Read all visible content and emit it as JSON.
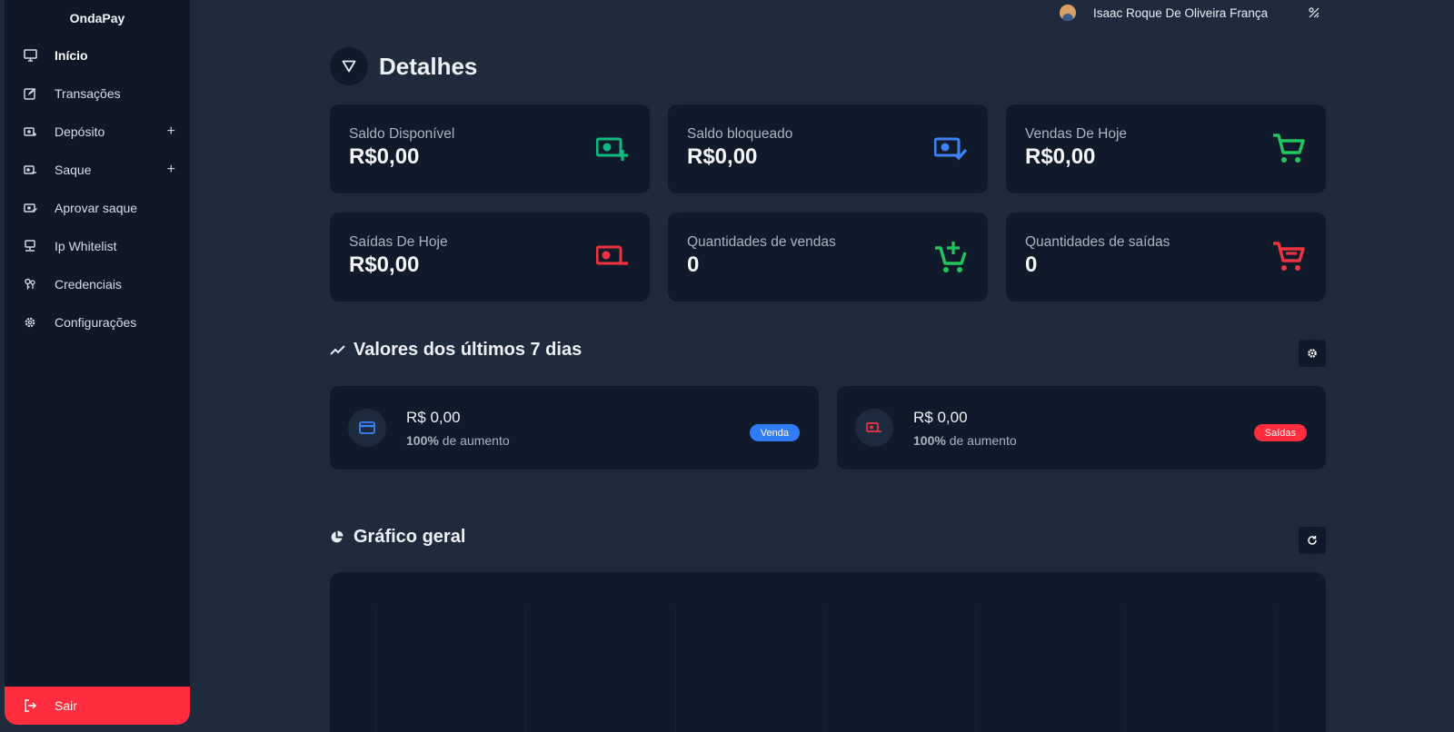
{
  "sidebar": {
    "brand": "OndaPay",
    "items": [
      {
        "label": "Início",
        "icon": "monitor-icon"
      },
      {
        "label": "Transações",
        "icon": "edit-icon"
      },
      {
        "label": "Depósito",
        "icon": "money-plus-icon"
      },
      {
        "label": "Saque",
        "icon": "money-minus-icon"
      },
      {
        "label": "Aprovar saque",
        "icon": "money-check-icon"
      },
      {
        "label": "Ip Whitelist",
        "icon": "network-icon"
      },
      {
        "label": "Credenciais",
        "icon": "keys-icon"
      },
      {
        "label": "Configurações",
        "icon": "gear-icon"
      }
    ],
    "expand_symbol": "+",
    "logout_label": "Sair"
  },
  "topbar": {
    "user_name": "Isaac Roque De Oliveira França"
  },
  "page": {
    "title": "Detalhes"
  },
  "cards": [
    {
      "label": "Saldo Disponível",
      "value": "R$0,00",
      "icon": "money-plus-icon",
      "color": "#10b981"
    },
    {
      "label": "Saldo bloqueado",
      "value": "R$0,00",
      "icon": "money-check-icon",
      "color": "#3b82f6"
    },
    {
      "label": "Vendas De Hoje",
      "value": "R$0,00",
      "icon": "cart-icon",
      "color": "#22c55e"
    },
    {
      "label": "Saídas De Hoje",
      "value": "R$0,00",
      "icon": "money-minus-icon",
      "color": "#ef3340"
    },
    {
      "label": "Quantidades de vendas",
      "value": "0",
      "icon": "cart-plus-icon",
      "color": "#22c55e"
    },
    {
      "label": "Quantidades de saídas",
      "value": "0",
      "icon": "cart-minus-icon",
      "color": "#ef3340"
    }
  ],
  "last7": {
    "title": "Valores dos últimos 7 dias",
    "items": [
      {
        "amount": "R$ 0,00",
        "percent": "100%",
        "suffix": " de aumento",
        "pill": "Venda",
        "pill_color": "#2f7cf6"
      },
      {
        "amount": "R$ 0,00",
        "percent": "100%",
        "suffix": " de aumento",
        "pill": "Saídas",
        "pill_color": "#ff2d3d"
      }
    ]
  },
  "general_chart": {
    "title": "Gráfico geral"
  }
}
